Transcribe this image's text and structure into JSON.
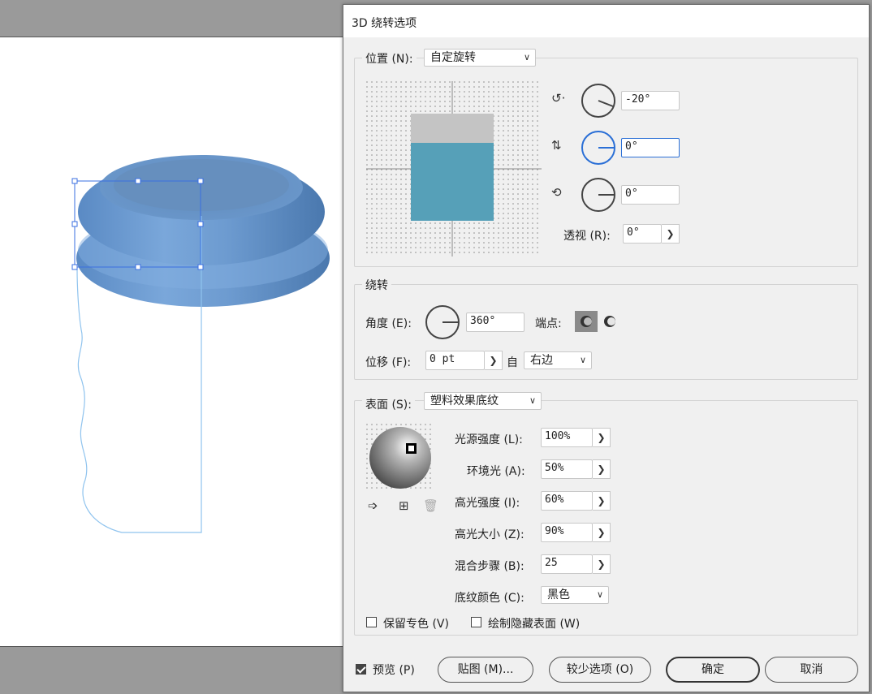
{
  "dialog": {
    "title": "3D 绕转选项"
  },
  "position": {
    "label": "位置 (N):",
    "selected": "自定旋转",
    "x_rotation": "-20°",
    "y_rotation": "0°",
    "z_rotation": "0°",
    "perspective_label": "透视 (R):",
    "perspective": "0°"
  },
  "revolve": {
    "legend": "绕转",
    "angle_label": "角度 (E):",
    "angle": "360°",
    "cap_label": "端点:",
    "offset_label": "位移 (F):",
    "offset": "0 pt",
    "from_label": "自",
    "from_selected": "右边"
  },
  "surface": {
    "label": "表面 (S):",
    "selected": "塑料效果底纹",
    "light_intensity_label": "光源强度 (L):",
    "light_intensity": "100%",
    "ambient_label": "环境光 (A):",
    "ambient": "50%",
    "highlight_intensity_label": "高光强度 (I):",
    "highlight_intensity": "60%",
    "highlight_size_label": "高光大小 (Z):",
    "highlight_size": "90%",
    "blend_steps_label": "混合步骤 (B):",
    "blend_steps": "25",
    "shade_color_label": "底纹颜色 (C):",
    "shade_color": "黑色",
    "preserve_spot_label": "保留专色 (V)",
    "draw_hidden_label": "绘制隐藏表面 (W)"
  },
  "footer": {
    "preview_label": "预览 (P)",
    "map_art_label": "贴图 (M)...",
    "fewer_options_label": "较少选项 (O)",
    "ok_label": "确定",
    "cancel_label": "取消"
  },
  "colors": {
    "accent": "#2a6fd6",
    "object_blue": "#5a8dc4",
    "cube_teal": "#56a0b8"
  },
  "icons": [
    "x-rotate-icon",
    "y-rotate-icon",
    "z-rotate-icon",
    "cap-on-icon",
    "cap-off-icon",
    "move-light-back-icon",
    "new-light-icon",
    "delete-light-icon",
    "chevron-right-icon",
    "chevron-down-icon"
  ]
}
